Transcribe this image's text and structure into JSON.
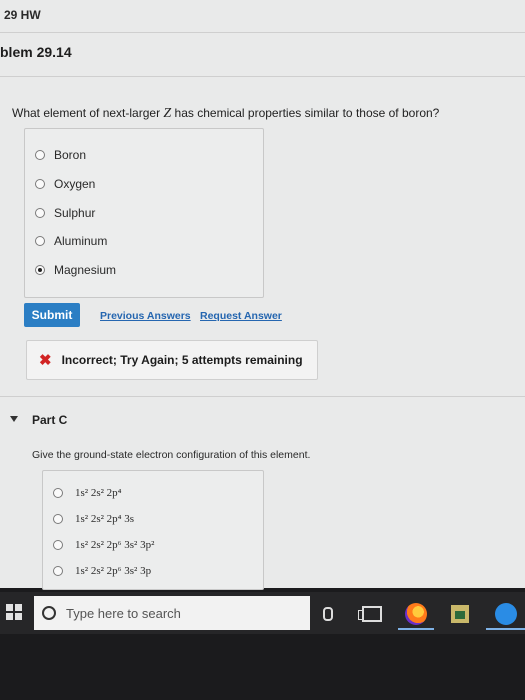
{
  "header": {
    "hw_title": "29 HW",
    "problem_title": "blem 29.14"
  },
  "part_b": {
    "question_before": "What element of next-larger ",
    "question_var": "Z",
    "question_after": " has chemical properties similar to those of boron?",
    "options": [
      {
        "label": "Boron",
        "selected": false
      },
      {
        "label": "Oxygen",
        "selected": false
      },
      {
        "label": "Sulphur",
        "selected": false
      },
      {
        "label": "Aluminum",
        "selected": false
      },
      {
        "label": "Magnesium",
        "selected": true
      }
    ],
    "submit_label": "Submit",
    "previous_answers_label": "Previous Answers",
    "request_answer_label": "Request Answer",
    "feedback_text": "Incorrect; Try Again; 5 attempts remaining"
  },
  "part_c": {
    "label": "Part C",
    "question": "Give the ground-state electron configuration of this element.",
    "options": [
      "1s² 2s² 2p⁴",
      "1s² 2s² 2p⁴ 3s",
      "1s² 2s² 2p⁶ 3s² 3p²",
      "1s² 2s² 2p⁶ 3s² 3p"
    ]
  },
  "taskbar": {
    "search_placeholder": "Type here to search",
    "icons": [
      "windows-start-icon",
      "microphone-icon",
      "task-view-icon",
      "firefox-icon",
      "store-icon",
      "edge-icon"
    ]
  }
}
